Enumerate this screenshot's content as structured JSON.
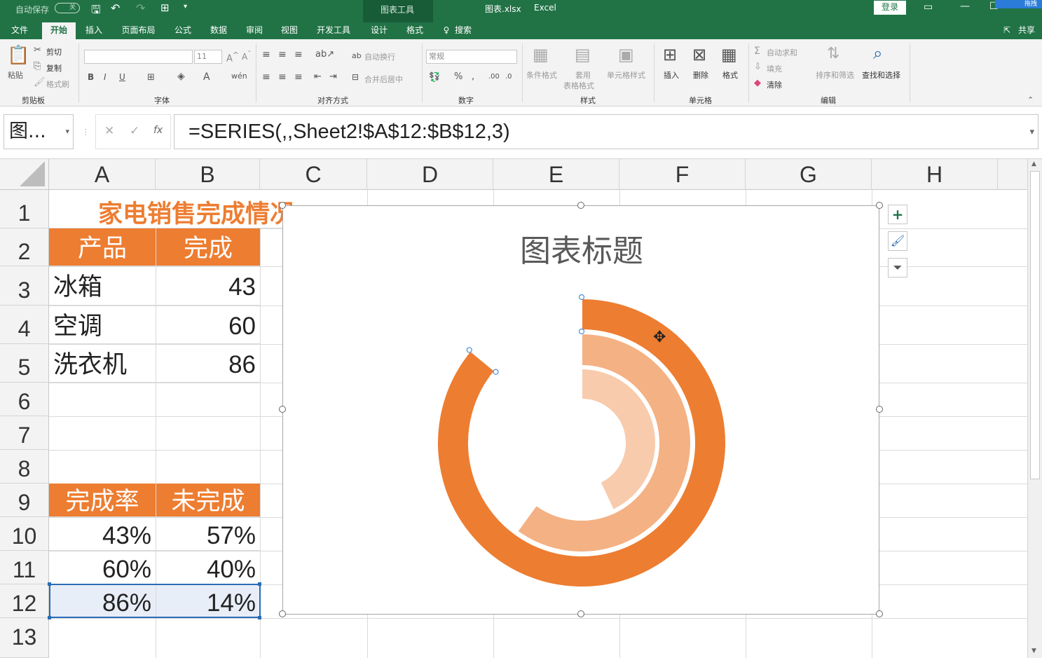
{
  "titlebar": {
    "autosave_label": "自动保存",
    "autosave_state": "关",
    "context_tab": "图表工具",
    "file_title": "图表.xlsx",
    "app_name": "Excel",
    "login_label": "登录",
    "corner_text": "拖拽"
  },
  "tabs": [
    {
      "label": "文件"
    },
    {
      "label": "开始"
    },
    {
      "label": "插入"
    },
    {
      "label": "页面布局"
    },
    {
      "label": "公式"
    },
    {
      "label": "数据"
    },
    {
      "label": "审阅"
    },
    {
      "label": "视图"
    },
    {
      "label": "开发工具"
    },
    {
      "label": "设计"
    },
    {
      "label": "格式"
    }
  ],
  "tell_me": "搜索",
  "share_label": "共享",
  "ribbon": {
    "paste": "粘贴",
    "cut": "剪切",
    "copy": "复制",
    "format_painter": "格式刷",
    "clipboard_group": "剪贴板",
    "font_size": "11",
    "font_group": "字体",
    "wrap_text": "自动换行",
    "merge_center": "合并后居中",
    "align_group": "对齐方式",
    "number_format": "常规",
    "number_group": "数字",
    "cond_format": "条件格式",
    "table_format_line1": "套用",
    "table_format_line2": "表格格式",
    "cell_styles": "单元格样式",
    "styles_group": "样式",
    "insert": "插入",
    "delete": "删除",
    "format": "格式",
    "cells_group": "单元格",
    "autosum": "自动求和",
    "fill": "填充",
    "clear": "清除",
    "sort_filter": "排序和筛选",
    "find_select": "查找和选择",
    "edit_group": "编辑"
  },
  "formula_bar": {
    "name_box": "图...",
    "formula": "=SERIES(,,Sheet2!$A$12:$B$12,3)"
  },
  "columns": [
    "A",
    "B",
    "C",
    "D",
    "E",
    "F",
    "G",
    "H"
  ],
  "rows": [
    "1",
    "2",
    "3",
    "4",
    "5",
    "6",
    "7",
    "8",
    "9",
    "10",
    "11",
    "12",
    "13"
  ],
  "sheet": {
    "title": "家电销售完成情况",
    "table1_header": [
      "产品",
      "完成"
    ],
    "table1_rows": [
      {
        "product": "冰箱",
        "value": "43"
      },
      {
        "product": "空调",
        "value": "60"
      },
      {
        "product": "洗衣机",
        "value": "86"
      }
    ],
    "table2_header": [
      "完成率",
      "未完成"
    ],
    "table2_rows": [
      {
        "rate": "43%",
        "remain": "57%"
      },
      {
        "rate": "60%",
        "remain": "40%"
      },
      {
        "rate": "86%",
        "remain": "14%"
      }
    ]
  },
  "chart_data": {
    "type": "doughnut",
    "title": "图表标题",
    "rings": [
      {
        "name": "冰箱",
        "completed": 0.43,
        "color": "#f8cbad"
      },
      {
        "name": "空调",
        "completed": 0.6,
        "color": "#f4b183"
      },
      {
        "name": "洗衣机",
        "completed": 0.86,
        "color": "#ed7d31"
      }
    ]
  },
  "colors": {
    "excel_green": "#217346",
    "header_orange": "#ed7d31",
    "title_orange": "#ed7d31"
  }
}
